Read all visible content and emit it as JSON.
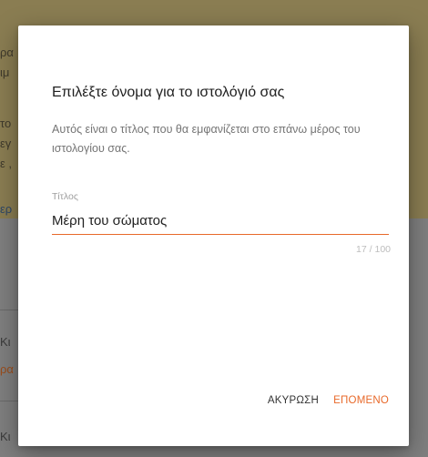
{
  "dialog": {
    "title": "Επιλέξτε όνομα για το ιστολόγιό σας",
    "description": "Αυτός είναι ο τίτλος που θα εμφανίζεται στο επάνω μέρος του ιστολογίου σας.",
    "field_label": "Τίτλος",
    "field_value": "Μέρη του σώματος",
    "char_count": "17 / 100",
    "cancel_label": "ΑΚΥΡΩΣΗ",
    "next_label": "ΕΠΟΜΕΝΟ"
  },
  "background": {
    "fragments": [
      "ρα",
      "ιμ",
      "το",
      "εγ",
      "ε ,",
      "ερ",
      "Κι",
      "ρα",
      "Κι"
    ]
  },
  "colors": {
    "accent": "#e8692a",
    "overlay_top": "#8a7d52",
    "overlay_bottom": "#7f7f7f"
  }
}
